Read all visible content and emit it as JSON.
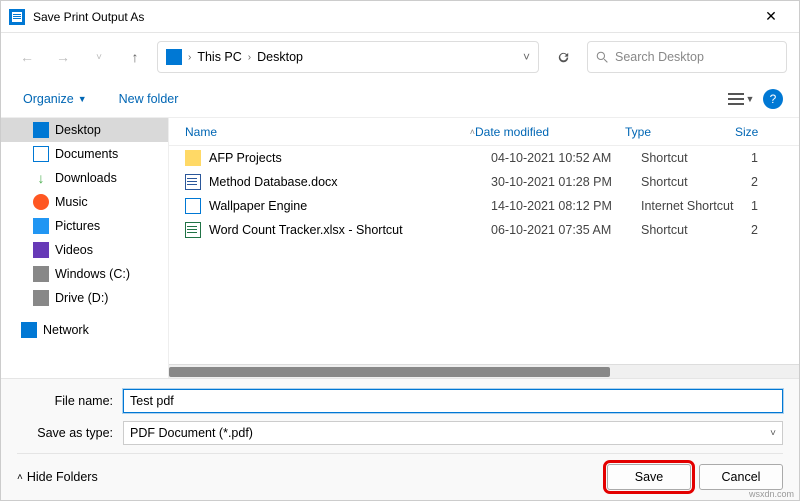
{
  "title": "Save Print Output As",
  "breadcrumb": {
    "root": "This PC",
    "folder": "Desktop"
  },
  "search": {
    "placeholder": "Search Desktop"
  },
  "toolbar": {
    "organize": "Organize",
    "newfolder": "New folder"
  },
  "columns": {
    "name": "Name",
    "date": "Date modified",
    "type": "Type",
    "size": "Size"
  },
  "sidebar": {
    "items": [
      {
        "label": "Desktop"
      },
      {
        "label": "Documents"
      },
      {
        "label": "Downloads"
      },
      {
        "label": "Music"
      },
      {
        "label": "Pictures"
      },
      {
        "label": "Videos"
      },
      {
        "label": "Windows (C:)"
      },
      {
        "label": "Drive (D:)"
      }
    ],
    "network": "Network"
  },
  "files": [
    {
      "name": "AFP Projects",
      "date": "04-10-2021 10:52 AM",
      "type": "Shortcut",
      "size": "1"
    },
    {
      "name": "Method Database.docx",
      "date": "30-10-2021 01:28 PM",
      "type": "Shortcut",
      "size": "2"
    },
    {
      "name": "Wallpaper Engine",
      "date": "14-10-2021 08:12 PM",
      "type": "Internet Shortcut",
      "size": "1"
    },
    {
      "name": "Word Count Tracker.xlsx - Shortcut",
      "date": "06-10-2021 07:35 AM",
      "type": "Shortcut",
      "size": "2"
    }
  ],
  "form": {
    "filename_label": "File name:",
    "filename_value": "Test pdf",
    "type_label": "Save as type:",
    "type_value": "PDF Document (*.pdf)"
  },
  "actions": {
    "hide": "Hide Folders",
    "save": "Save",
    "cancel": "Cancel"
  },
  "watermark": "wsxdn.com"
}
